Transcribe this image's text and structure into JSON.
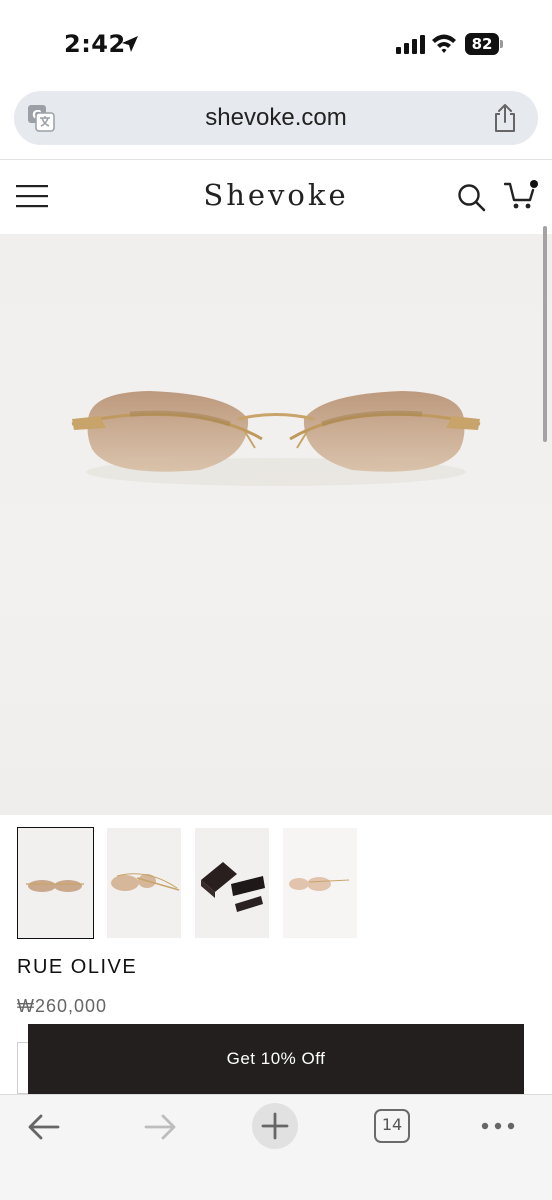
{
  "status_bar": {
    "time": "2:42",
    "battery": "82"
  },
  "address_bar": {
    "url": "shevoke.com"
  },
  "site_header": {
    "brand": "Shevoke"
  },
  "product": {
    "name": "RUE OLIVE",
    "price": "₩260,000"
  },
  "promo": {
    "label": "Get 10% Off"
  },
  "toolbar": {
    "tab_count": "14"
  },
  "icons": {
    "status": [
      "location-arrow-icon",
      "signal-icon",
      "wifi-icon",
      "battery-icon"
    ],
    "address": [
      "translate-icon",
      "share-icon"
    ],
    "header": [
      "menu-icon",
      "search-icon",
      "cart-icon"
    ],
    "toolbar": [
      "back-icon",
      "forward-icon",
      "plus-icon",
      "tabs-icon",
      "more-icon"
    ]
  },
  "colors": {
    "promo_bg": "#231f1f",
    "address_bar_bg": "#e6e9ee",
    "lens_tint": "#c9a88c",
    "frame_gold": "#c8a46a"
  }
}
